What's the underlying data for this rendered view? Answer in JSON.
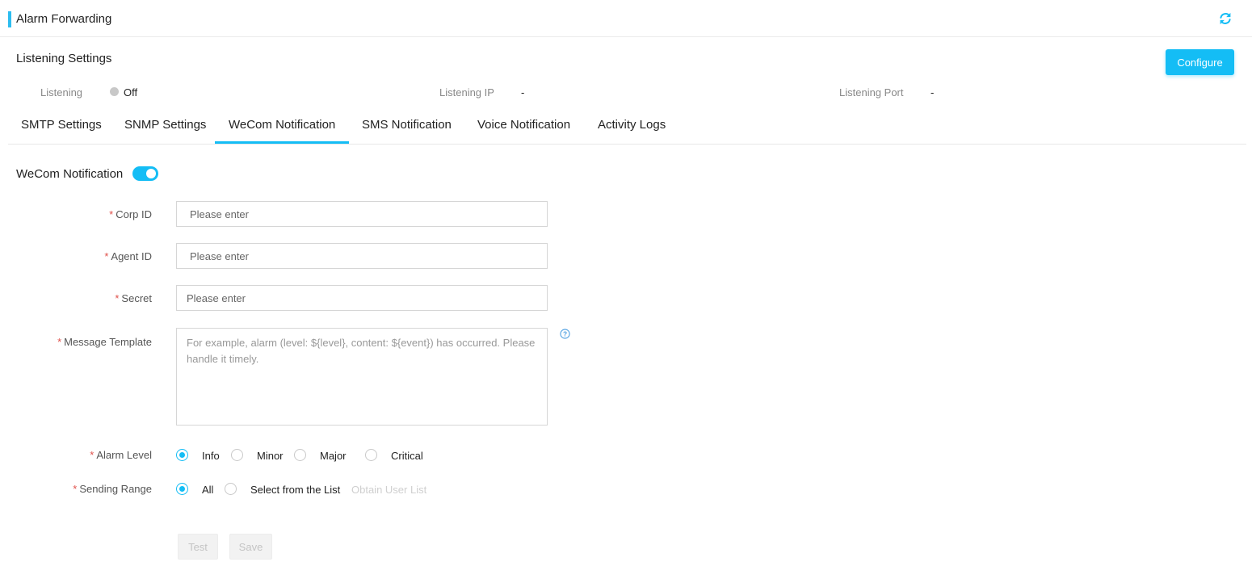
{
  "header": {
    "title": "Alarm Forwarding",
    "refresh_icon": "refresh-icon",
    "accent": "#2dbdf0"
  },
  "listening": {
    "section_title": "Listening Settings",
    "configure_label": "Configure",
    "listening_label": "Listening",
    "listening_status": "Off",
    "ip_label": "Listening IP",
    "ip_value": "-",
    "port_label": "Listening Port",
    "port_value": "-"
  },
  "tabs": [
    {
      "label": "SMTP Settings",
      "active": false
    },
    {
      "label": "SNMP Settings",
      "active": false
    },
    {
      "label": "WeCom Notification",
      "active": true
    },
    {
      "label": "SMS Notification",
      "active": false
    },
    {
      "label": "Voice Notification",
      "active": false
    },
    {
      "label": "Activity Logs",
      "active": false
    }
  ],
  "form": {
    "toggle_label": "WeCom Notification",
    "toggle_on": true,
    "required_mark": "*",
    "corp_id": {
      "label": "Corp ID",
      "placeholder": "Please enter",
      "value": ""
    },
    "agent_id": {
      "label": "Agent ID",
      "placeholder": "Please enter",
      "value": ""
    },
    "secret": {
      "label": "Secret",
      "placeholder": "Please enter",
      "value": ""
    },
    "template": {
      "label": "Message Template",
      "placeholder": "For example, alarm (level: ${level}, content: ${event}) has occurred. Please handle it timely.",
      "value": ""
    },
    "alarm_level": {
      "label": "Alarm Level",
      "options": [
        "Info",
        "Minor",
        "Major",
        "Critical"
      ],
      "selected": "Info"
    },
    "sending_range": {
      "label": "Sending Range",
      "options": [
        "All",
        "Select from the List"
      ],
      "selected": "All",
      "link": "Obtain User List"
    },
    "test_label": "Test",
    "save_label": "Save"
  },
  "colors": {
    "primary": "#14bdf5",
    "required": "#e0504a"
  }
}
